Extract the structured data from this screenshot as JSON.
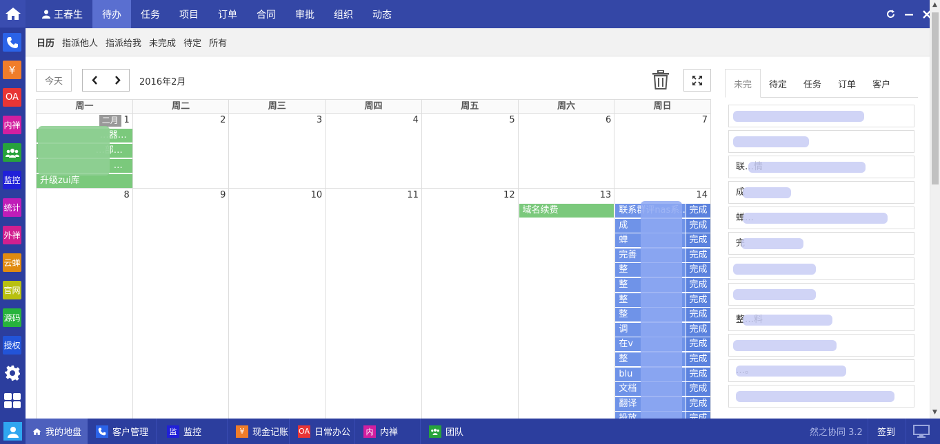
{
  "top_nav": {
    "user": "王春生",
    "items": [
      "待办",
      "任务",
      "项目",
      "订单",
      "合同",
      "审批",
      "组织",
      "动态"
    ]
  },
  "left_sidebar": {
    "items": [
      {
        "label": "",
        "icon": "phone-icon",
        "color": "#2b63e8"
      },
      {
        "label": "¥",
        "icon": "yen-icon",
        "color": "#f07d2a"
      },
      {
        "label": "OA",
        "icon": "oa-icon",
        "color": "#e83535"
      },
      {
        "label": "内禅",
        "icon": "neichan-icon",
        "color": "#d21fa0"
      },
      {
        "label": "",
        "icon": "team-icon",
        "color": "#27a33c"
      },
      {
        "label": "监控",
        "icon": "monitor-icon",
        "color": "#2020d8"
      },
      {
        "label": "统计",
        "icon": "stats-icon",
        "color": "#c01db8"
      },
      {
        "label": "外禅",
        "icon": "waichan-icon",
        "color": "#d11f8f"
      },
      {
        "label": "云蝉",
        "icon": "yunchan-icon",
        "color": "#e08a10"
      },
      {
        "label": "官网",
        "icon": "site-icon",
        "color": "#b8c010"
      },
      {
        "label": "源码",
        "icon": "source-icon",
        "color": "#27b33c"
      },
      {
        "label": "授权",
        "icon": "license-icon",
        "color": "#2254d8"
      }
    ]
  },
  "sub_nav": {
    "items": [
      "日历",
      "指派他人",
      "指派给我",
      "未完成",
      "待定",
      "所有"
    ]
  },
  "toolbar": {
    "today": "今天",
    "month_title": "2016年2月"
  },
  "calendar": {
    "weekdays": [
      "周一",
      "周二",
      "周三",
      "周四",
      "周五",
      "周六",
      "周日"
    ],
    "week1": {
      "month_tag": "二月",
      "days": [
        "1",
        "2",
        "3",
        "4",
        "5",
        "6",
        "7"
      ],
      "mon_events": [
        "…器…",
        "…部…",
        "…",
        "升级zui库"
      ]
    },
    "week2": {
      "days": [
        "8",
        "9",
        "10",
        "11",
        "12",
        "13",
        "14"
      ],
      "sat_event": "域名续费",
      "done_label": "完成",
      "sun_events": [
        "联系群评nas系…",
        "成",
        "蝉",
        "完善",
        "整",
        "整",
        "整",
        "整",
        "调",
        "在v",
        "整",
        "blu",
        "文档",
        "翻译",
        "投放"
      ]
    }
  },
  "right_panel": {
    "tabs": [
      "未完",
      "待定",
      "任务",
      "订单",
      "客户"
    ],
    "items": [
      "",
      "",
      "联…情",
      "成",
      "蝉…",
      "完",
      "",
      "",
      "整…料",
      "",
      "…。",
      ""
    ]
  },
  "bottom_bar": {
    "home": "我的地盘",
    "apps": [
      {
        "label": "客户管理",
        "icon": "phone-icon",
        "color": "#2b63e8",
        "badge": ""
      },
      {
        "label": "监控",
        "icon": "monitor-icon",
        "color": "#2020d8",
        "badge": "监"
      },
      {
        "label": "现金记账",
        "icon": "yen-icon",
        "color": "#f07d2a",
        "badge": "¥"
      },
      {
        "label": "日常办公",
        "icon": "oa-icon",
        "color": "#e83535",
        "badge": "OA"
      },
      {
        "label": "内禅",
        "icon": "neichan-icon",
        "color": "#d21fa0",
        "badge": "内"
      },
      {
        "label": "团队",
        "icon": "team-icon",
        "color": "#27a33c",
        "badge": ""
      }
    ],
    "version": "然之协同 3.2",
    "signin": "签到"
  }
}
